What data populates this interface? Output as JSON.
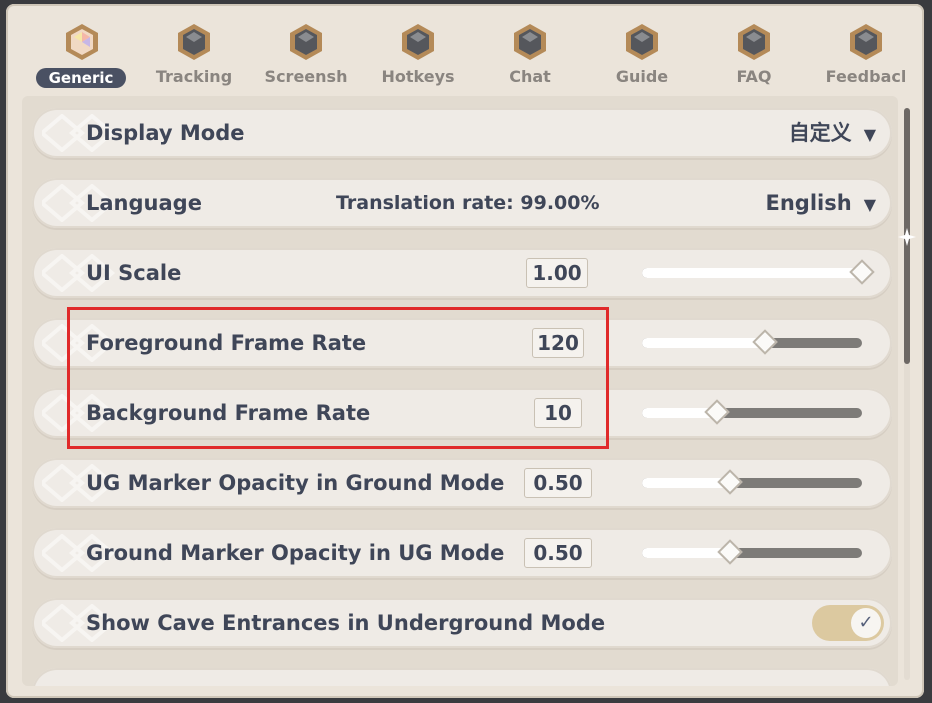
{
  "tabs": [
    {
      "label": "Generic",
      "active": true,
      "icon": "gem-settings-icon"
    },
    {
      "label": "Tracking",
      "active": false,
      "icon": "hex-settings-icon"
    },
    {
      "label": "Screensh",
      "active": false,
      "icon": "hex-settings-icon"
    },
    {
      "label": "Hotkeys",
      "active": false,
      "icon": "hex-settings-icon"
    },
    {
      "label": "Chat",
      "active": false,
      "icon": "hex-settings-icon"
    },
    {
      "label": "Guide",
      "active": false,
      "icon": "hex-settings-icon"
    },
    {
      "label": "FAQ",
      "active": false,
      "icon": "hex-settings-icon"
    },
    {
      "label": "Feedbacl",
      "active": false,
      "icon": "hex-settings-icon"
    }
  ],
  "settings": {
    "display_mode": {
      "label": "Display Mode",
      "value": "自定义"
    },
    "language": {
      "label": "Language",
      "translation_rate": "Translation rate: 99.00%",
      "value": "English"
    },
    "ui_scale": {
      "label": "UI Scale",
      "value": "1.00",
      "slider_fraction": 1.0
    },
    "foreground_frame_rate": {
      "label": "Foreground Frame Rate",
      "value": "120",
      "slider_fraction": 0.55
    },
    "background_frame_rate": {
      "label": "Background Frame Rate",
      "value": "10",
      "slider_fraction": 0.33
    },
    "ug_marker_opacity": {
      "label": "UG Marker Opacity in Ground Mode",
      "value": "0.50",
      "slider_fraction": 0.39
    },
    "ground_marker_opacity": {
      "label": "Ground Marker Opacity in UG Mode",
      "value": "0.50",
      "slider_fraction": 0.39
    },
    "show_cave_entrances": {
      "label": "Show Cave Entrances in Underground Mode",
      "checked": true
    }
  },
  "colors": {
    "accent": "#4a5163",
    "highlight": "#e02a2a",
    "toggle_on": "#dcc9a0"
  }
}
